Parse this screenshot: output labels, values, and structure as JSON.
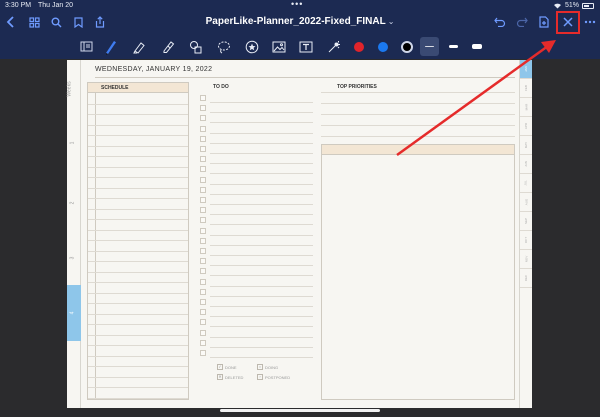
{
  "status": {
    "time": "3:30 PM",
    "date": "Thu Jan 20",
    "battery": "51%",
    "dots": "•••"
  },
  "nav": {
    "title": "PaperLike-Planner_2022-Fixed_FINAL",
    "title_chevron": "⌄"
  },
  "toolbar": {
    "colors": {
      "red": "#e0242b",
      "blue": "#1b79f0",
      "black": "#000000"
    },
    "accent": "#6f9bff"
  },
  "planner": {
    "date_heading": "WEDNESDAY, JANUARY 19, 2022",
    "schedule_label": "SCHEDULE",
    "todo_label": "TO DO",
    "priorities_label": "TOP PRIORITIES",
    "left_strip": {
      "weeks": "Weeks",
      "w1": "1",
      "w2": "2",
      "w3": "3",
      "w4": "4"
    },
    "legend": {
      "done": "DONE",
      "doing": "DOING",
      "deleted": "DELETED",
      "postponed": "POSTPONED"
    },
    "months": [
      "JAN",
      "FEB",
      "MAR",
      "APR",
      "MAY",
      "JUN",
      "JUL",
      "AUG",
      "SEP",
      "OCT",
      "NOV",
      "DEC"
    ],
    "active_month": "JAN"
  }
}
